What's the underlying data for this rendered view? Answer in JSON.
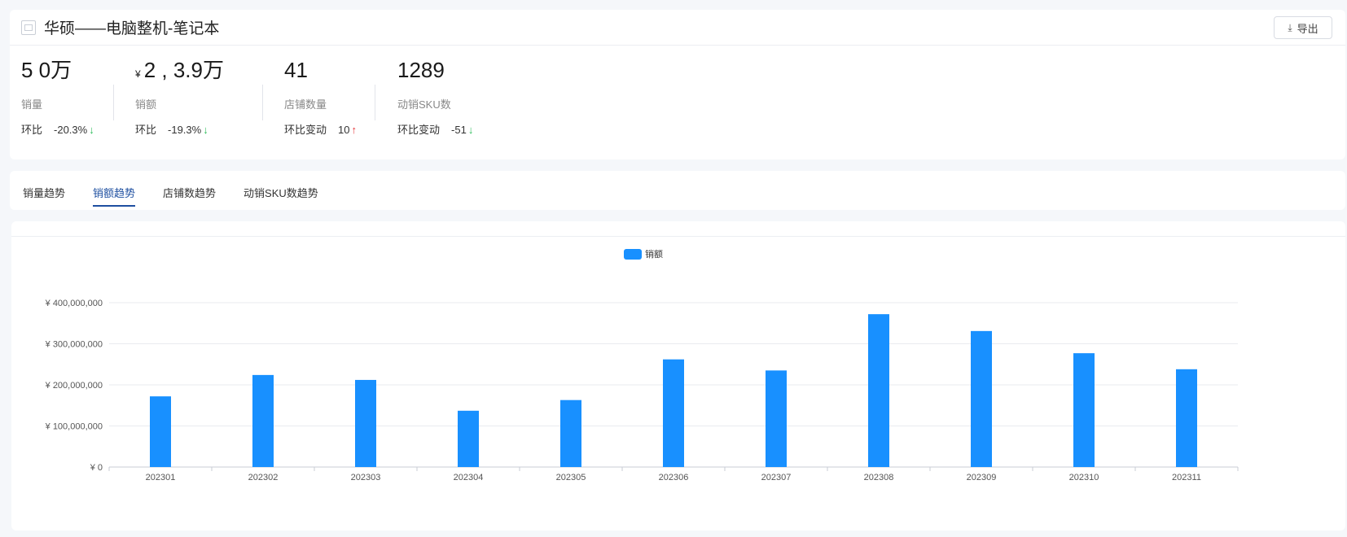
{
  "header": {
    "title": "华硕——电脑整机-笔记本",
    "export_label": "导出"
  },
  "metrics": [
    {
      "value": "5  0万",
      "prefix": "",
      "label": "销量",
      "cmp_label": "环比",
      "cmp_value": "-20.3%",
      "dir": "down"
    },
    {
      "value": "2  ,  3.9万",
      "prefix": "¥",
      "label": "销额",
      "cmp_label": "环比",
      "cmp_value": "-19.3%",
      "dir": "down"
    },
    {
      "value": "41",
      "prefix": "",
      "label": "店铺数量",
      "cmp_label": "环比变动",
      "cmp_value": "10",
      "dir": "up"
    },
    {
      "value": "1289",
      "prefix": "",
      "label": "动销SKU数",
      "cmp_label": "环比变动",
      "cmp_value": "-51",
      "dir": "down"
    }
  ],
  "tabs": [
    {
      "label": "销量趋势",
      "active": false
    },
    {
      "label": "销额趋势",
      "active": true
    },
    {
      "label": "店铺数趋势",
      "active": false
    },
    {
      "label": "动销SKU数趋势",
      "active": false
    }
  ],
  "colors": {
    "bar": "#1890ff",
    "active_tab": "#1e4fa0",
    "down": "#2ebd5b",
    "up": "#e5383b"
  },
  "chart_data": {
    "type": "bar",
    "categories": [
      "202301",
      "202302",
      "202303",
      "202304",
      "202305",
      "202306",
      "202307",
      "202308",
      "202309",
      "202310",
      "202311"
    ],
    "series": [
      {
        "name": "销额",
        "values": [
          172000000,
          224000000,
          212000000,
          137000000,
          163000000,
          262000000,
          235000000,
          372000000,
          331000000,
          277000000,
          238000000
        ]
      }
    ],
    "ylim": [
      0,
      400000000
    ],
    "yticks": [
      0,
      100000000,
      200000000,
      300000000,
      400000000
    ],
    "ytick_labels": [
      "¥ 0",
      "¥ 100,000,000",
      "¥ 200,000,000",
      "¥ 300,000,000",
      "¥ 400,000,000"
    ],
    "legend_position": "top-center",
    "grid": true
  }
}
